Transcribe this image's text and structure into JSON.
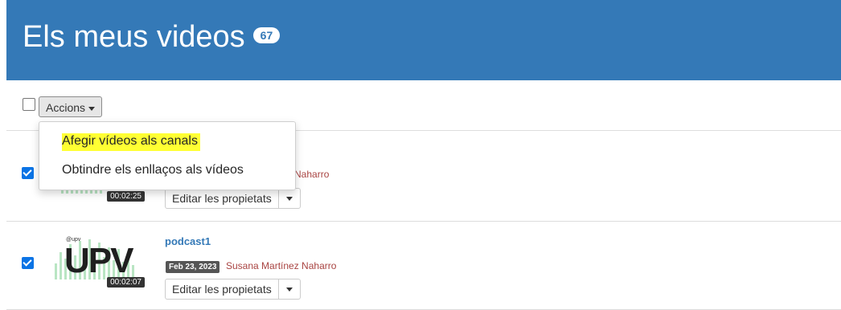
{
  "header": {
    "title": "Els meus videos",
    "count": "67"
  },
  "toolbar": {
    "actions_label": "Accions"
  },
  "actions_menu": {
    "items": [
      "Afegir vídeos als canals",
      "Obtindre els enllaços als vídeos"
    ],
    "highlight_color": "#ffff33"
  },
  "videos": [
    {
      "title": "",
      "date": "",
      "owner": "ez Naharro",
      "duration": "00:02:25",
      "edit_label": "Editar les propietats",
      "checked": true
    },
    {
      "title": "podcast1",
      "date": "Feb 23, 2023",
      "owner": "Susana Martínez Naharro",
      "duration": "00:02:07",
      "edit_label": "Editar les propietats",
      "checked": true,
      "thumb_brand": "@upv",
      "thumb_logo": "UPV"
    }
  ],
  "colors": {
    "header_bg": "#3479b7",
    "link": "#3479b7",
    "owner": "#a94442",
    "checkbox": "#0b74e5"
  }
}
